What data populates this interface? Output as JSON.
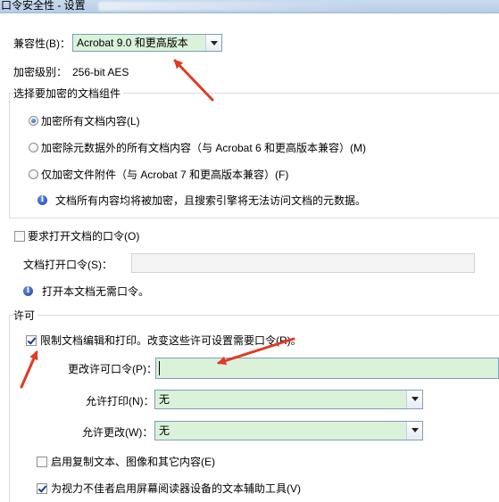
{
  "window": {
    "title": "口令安全性 - 设置"
  },
  "compatibility": {
    "label": "兼容性(B)：",
    "selected": "Acrobat 9.0 和更高版本"
  },
  "encryption_level": {
    "label": "加密级别：",
    "value": "256-bit AES"
  },
  "components_group": {
    "caption": "选择要加密的文档组件",
    "options": [
      {
        "label": "加密所有文档内容(L)",
        "checked": true
      },
      {
        "label": "加密除元数据外的所有文档内容（与 Acrobat 6 和更高版本兼容）(M)",
        "checked": false
      },
      {
        "label": "仅加密文件附件（与 Acrobat 7 和更高版本兼容）(F)",
        "checked": false
      }
    ],
    "info": "文档所有内容均将被加密，且搜索引擎将无法访问文档的元数据。"
  },
  "open_password": {
    "checkbox_label": "要求打开文档的口令(O)",
    "checked": false,
    "field_label": "文档打开口令(S)：",
    "value": "",
    "info": "打开本文档无需口令。"
  },
  "permissions": {
    "caption": "许可",
    "restrict_label": "限制文档编辑和打印。改变这些许可设置需要口令(R)。",
    "restrict_checked": true,
    "change_password_label": "更改许可口令(P)：",
    "change_password_value": "",
    "printing_label": "允许打印(N)：",
    "printing_value": "无",
    "changes_label": "允许更改(W)：",
    "changes_value": "无",
    "copy_label": "启用复制文本、图像和其它内容(E)",
    "copy_checked": false,
    "accessibility_label": "为视力不佳者启用屏幕阅读器设备的文本辅助工具(V)",
    "accessibility_checked": true
  },
  "colors": {
    "field_highlight": "#d9f2d9",
    "annotation_arrow": "#e03a25"
  }
}
